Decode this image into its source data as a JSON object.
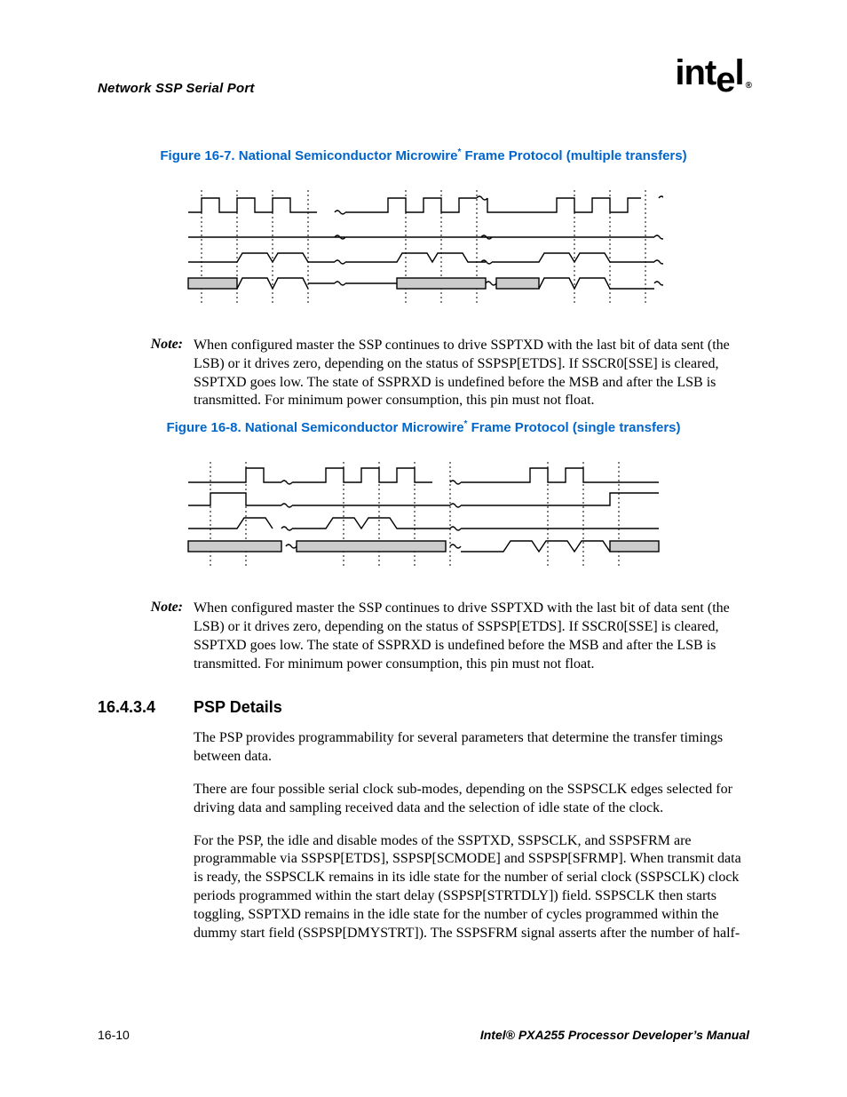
{
  "header": {
    "running_title": "Network SSP Serial Port",
    "logo_text": "intel"
  },
  "figure7": {
    "caption_prefix": "Figure 16-7. National Semiconductor Microwire",
    "sup": "*",
    "caption_suffix": " Frame Protocol (multiple transfers)"
  },
  "note1": {
    "label": "Note:",
    "body": "When configured master the SSP continues to drive SSPTXD with the last bit of data sent (the LSB) or it drives zero, depending on the status of SSPSP[ETDS]. If SSCR0[SSE] is cleared, SSPTXD goes low. The state of SSPRXD is undefined before the MSB and after the LSB is transmitted. For minimum power consumption, this pin must not float."
  },
  "figure8": {
    "caption_prefix": "Figure 16-8. National Semiconductor Microwire",
    "sup": "*",
    "caption_suffix": " Frame Protocol (single transfers)"
  },
  "note2": {
    "label": "Note:",
    "body": "When configured master the SSP continues to drive SSPTXD with the last bit of data sent (the LSB) or it drives zero, depending on the status of SSPSP[ETDS]. If SSCR0[SSE] is cleared, SSPTXD goes low. The state of SSPRXD is undefined before the MSB and after the LSB is transmitted. For minimum power consumption, this pin must not float."
  },
  "section": {
    "number": "16.4.3.4",
    "title": "PSP Details",
    "p1": "The PSP provides programmability for several parameters that determine the transfer timings between data.",
    "p2": "There are four possible serial clock sub-modes, depending on the SSPSCLK edges selected for driving data and sampling received data and the selection of idle state of the clock.",
    "p3": "For the PSP, the idle and disable modes of the SSPTXD, SSPSCLK, and SSPSFRM are programmable via SSPSP[ETDS], SSPSP[SCMODE] and SSPSP[SFRMP]. When transmit data is ready, the SSPSCLK remains in its idle state for the number of serial clock (SSPSCLK) clock periods programmed within the start delay (SSPSP[STRTDLY]) field. SSPSCLK then starts toggling, SSPTXD remains in the idle state for the number of cycles programmed within the dummy start field (SSPSP[DMYSTRT]). The SSPSFRM signal asserts after the number of half-"
  },
  "footer": {
    "left": "16-10",
    "right": "Intel® PXA255 Processor Developer’s Manual"
  }
}
